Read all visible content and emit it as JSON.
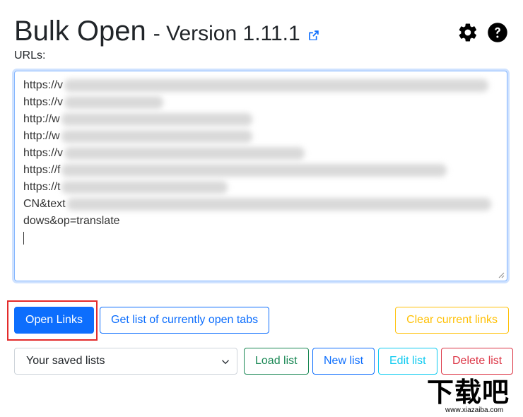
{
  "header": {
    "title": "Bulk Open",
    "version": "- Version 1.11.1",
    "external_link_icon": "external-link-icon",
    "settings_icon": "gear-icon",
    "help_icon": "question-circle-icon"
  },
  "urls_label": "URLs:",
  "url_lines": [
    "https://v",
    "https://v",
    "http://w",
    "http://w",
    "https://v",
    "https://f",
    "https://t",
    "CN&text",
    "dows&op=translate"
  ],
  "buttons": {
    "open_links": "Open Links",
    "get_tabs": "Get list of currently open tabs",
    "clear_links": "Clear current links",
    "load_list": "Load list",
    "new_list": "New list",
    "edit_list": "Edit list",
    "delete_list": "Delete list"
  },
  "saved_lists": {
    "selected": "Your saved lists"
  },
  "watermark": {
    "text": "下载吧",
    "url": "www.xiazaiba.com"
  },
  "colors": {
    "primary": "#0d6efd",
    "warning": "#ffc107",
    "success": "#198754",
    "info": "#0dcaf0",
    "danger": "#dc3545",
    "highlight": "#e32b2b"
  }
}
